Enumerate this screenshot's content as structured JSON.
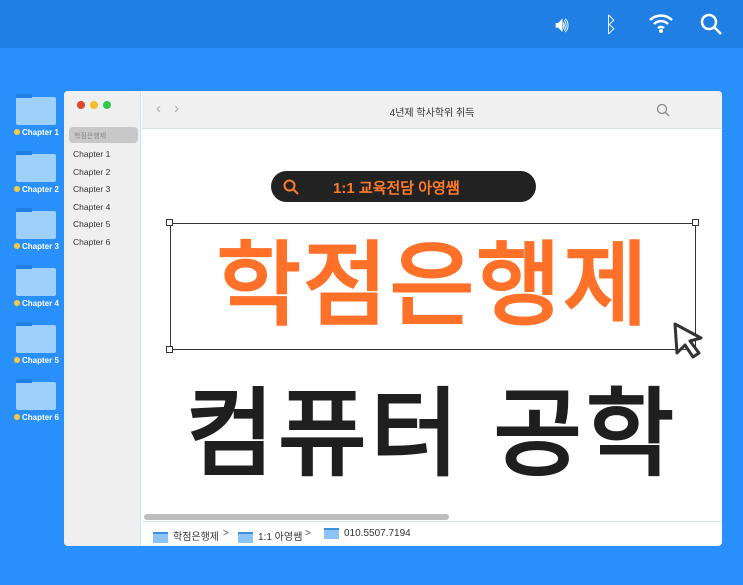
{
  "menubar": {
    "icons": [
      "speaker-icon",
      "bluetooth-icon",
      "wifi-icon",
      "search-icon"
    ]
  },
  "desktop": {
    "folders": [
      "Chapter 1",
      "Chapter 2",
      "Chapter 3",
      "Chapter 4",
      "Chapter 5",
      "Chapter 6"
    ]
  },
  "window": {
    "title": "4년제 학사학위 취득",
    "sidebar": {
      "selected": "학점은행제",
      "items": [
        "Chapter 1",
        "Chapter 2",
        "Chapter 3",
        "Chapter 4",
        "Chapter 5",
        "Chapter 6"
      ]
    },
    "content": {
      "search_pill": "1:1 교육전담 아영쌤",
      "headline": "학점은행제",
      "subheadline": "컴퓨터 공학"
    },
    "path": [
      "학점은행제",
      "1:1 아영쌤",
      "010.5507.7194"
    ],
    "path_sep": ">"
  },
  "colors": {
    "accent": "#ff7128",
    "background": "#2990fb"
  }
}
